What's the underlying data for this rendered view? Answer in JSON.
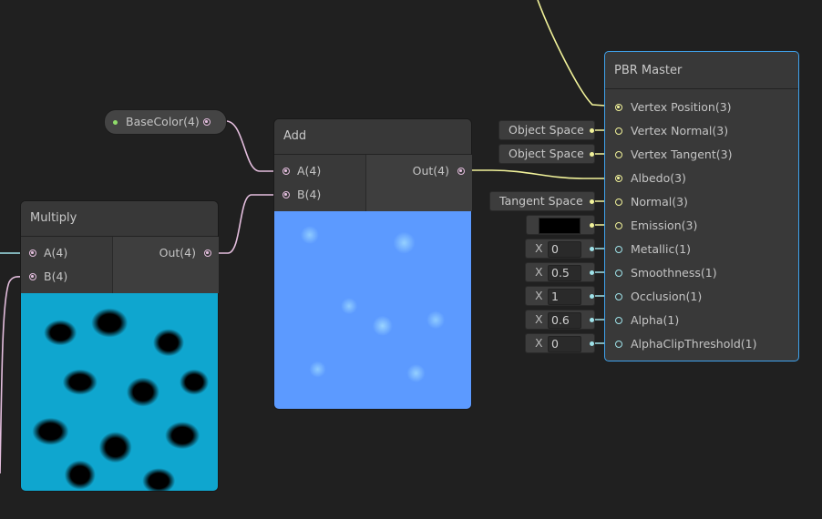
{
  "nodes": {
    "multiply": {
      "title": "Multiply",
      "inputs": [
        "A(4)",
        "B(4)"
      ],
      "output": "Out(4)"
    },
    "add": {
      "title": "Add",
      "inputs": [
        "A(4)",
        "B(4)"
      ],
      "output": "Out(4)"
    },
    "basecolor": {
      "label": "BaseColor(4)"
    },
    "master": {
      "title": "PBR Master",
      "inputs": [
        "Vertex Position(3)",
        "Vertex Normal(3)",
        "Vertex Tangent(3)",
        "Albedo(3)",
        "Normal(3)",
        "Emission(3)",
        "Metallic(1)",
        "Smoothness(1)",
        "Occlusion(1)",
        "Alpha(1)",
        "AlphaClipThreshold(1)"
      ]
    }
  },
  "inline_fields": {
    "vertex_normal_space": "Object Space",
    "vertex_tangent_space": "Object Space",
    "normal_space": "Tangent Space",
    "emission_color": "#000000",
    "metallic": {
      "axis": "X",
      "value": "0"
    },
    "smoothness": {
      "axis": "X",
      "value": "0.5"
    },
    "occlusion": {
      "axis": "X",
      "value": "1"
    },
    "alpha": {
      "axis": "X",
      "value": "0.6"
    },
    "alpha_clip": {
      "axis": "X",
      "value": "0"
    }
  },
  "colors": {
    "background": "#202020",
    "wire_vector4": "#e4bede",
    "wire_vector3": "#f2f39a",
    "wire_vector1": "#9fe3ea",
    "master_border": "#3fa3ee",
    "basecolor_dot": "#8fdc6a"
  }
}
